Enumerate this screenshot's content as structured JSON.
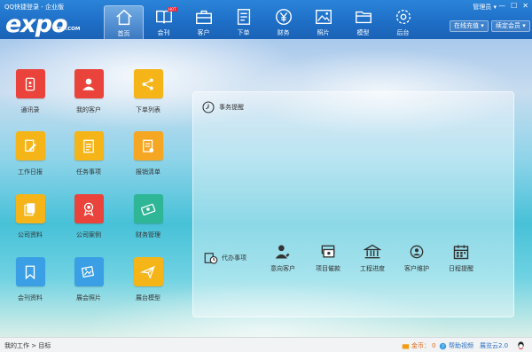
{
  "window": {
    "title": "QQ快捷登录 - 企业版",
    "user_menu": "管理员 ▾",
    "controls": [
      "—",
      "☐",
      "✕"
    ]
  },
  "logo": {
    "main": "expo",
    "sub": "ERP.COM"
  },
  "nav": [
    {
      "label": "首页",
      "icon": "home-icon",
      "active": true
    },
    {
      "label": "会刊",
      "icon": "book-icon",
      "badge": "HOT"
    },
    {
      "label": "客户",
      "icon": "briefcase-icon"
    },
    {
      "label": "下单",
      "icon": "document-icon"
    },
    {
      "label": "财务",
      "icon": "yen-icon"
    },
    {
      "label": "照片",
      "icon": "photo-icon"
    },
    {
      "label": "模型",
      "icon": "folder-icon"
    },
    {
      "label": "后台",
      "icon": "gear-icon"
    }
  ],
  "header_buttons": {
    "recharge": "在线充值 ▾",
    "renew": "续定会员 ▾"
  },
  "apps": [
    {
      "label": "通讯录",
      "icon": "contacts-icon",
      "color": "#e9433b"
    },
    {
      "label": "我的客户",
      "icon": "user-icon",
      "color": "#e9433b"
    },
    {
      "label": "下单列表",
      "icon": "share-icon",
      "color": "#f5b417"
    },
    {
      "label": "工作日报",
      "icon": "pencil-icon",
      "color": "#f5b417"
    },
    {
      "label": "任务事项",
      "icon": "task-icon",
      "color": "#f5b417"
    },
    {
      "label": "报销清单",
      "icon": "receipt-icon",
      "color": "#f5a623"
    },
    {
      "label": "公司资料",
      "icon": "files-icon",
      "color": "#f5b417"
    },
    {
      "label": "公司案例",
      "icon": "award-icon",
      "color": "#e9433b"
    },
    {
      "label": "财务管理",
      "icon": "money-icon",
      "color": "#2fb696"
    },
    {
      "label": "会刊资料",
      "icon": "bookmark-icon",
      "color": "#3b9fe6"
    },
    {
      "label": "展会照片",
      "icon": "gallery-icon",
      "color": "#3b9fe6"
    },
    {
      "label": "展台模型",
      "icon": "plane-icon",
      "color": "#f5b417"
    }
  ],
  "panel": {
    "reminder_title": "事务提醒",
    "todo_title": "代办事项",
    "todo_items": [
      {
        "label": "意向客户",
        "icon": "customer-icon"
      },
      {
        "label": "项目催款",
        "icon": "cash-icon"
      },
      {
        "label": "工程进度",
        "icon": "building-icon"
      },
      {
        "label": "客户维护",
        "icon": "support-icon"
      },
      {
        "label": "日程提醒",
        "icon": "calendar-icon"
      }
    ]
  },
  "status": {
    "breadcrumb": "我的工作 > 目标",
    "coins_label": "金币：",
    "coins_value": "0",
    "help": "帮助视频",
    "version": "展览云2.0"
  }
}
